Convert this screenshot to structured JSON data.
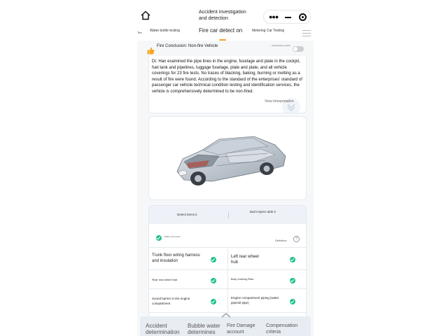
{
  "header": {
    "title_line1": "Accident investigation",
    "title_line2": "and detection",
    "icons": [
      "home-icon",
      "more-icon",
      "minimize-icon",
      "target-icon"
    ]
  },
  "tabs": {
    "side_label": "Tire",
    "items": [
      {
        "label": "Water bottle testing"
      },
      {
        "label": "Fire car detect on"
      },
      {
        "label": "Metering Car Testing"
      }
    ],
    "menu_icon": "menu-icon"
  },
  "conclusion": {
    "text": "Fire Conclusion: Non-fire Vehicle",
    "interp_label": "Interpretation switch"
  },
  "description": {
    "text": "Dr. Han examined the pipe lines in the engine, fuselage and plate in the cockpit, fuel tank and pipelines, luggage fuselage, plate and plate, and all vehicle coverings for 23 fire tests. No traces of blacking, baking, burning or melting as a result of fire were found. According to the standard of the enterprises' standard of passenger car vehicle technical condition testing and identification services, the vehicle is comprehensively determined to be non-fired.",
    "view_link": "View Interpretation"
  },
  "inspection": {
    "header_left": "Detect items it",
    "header_right": "Bad inspect able it",
    "legend_label": "Buffer temp tests",
    "definition_label": "Definition",
    "help_symbol": "?",
    "items": [
      {
        "label": "Trunk floor wiring harness and insulation"
      },
      {
        "label": "Left rear wheel hub"
      },
      {
        "label": "Rear rear wheel hub"
      },
      {
        "label": "Body Covering Parts"
      },
      {
        "label": "Sound barrier in the engine compartment"
      },
      {
        "label": "Engine compartment piping (water pipe/oil pipe)"
      }
    ]
  },
  "bottom_nav": {
    "items": [
      {
        "line1": "Accident",
        "line2": "determination"
      },
      {
        "line1": "Bubble water",
        "line2": "determines"
      },
      {
        "line1": "Fire Damage",
        "line2": "account"
      },
      {
        "line1": "Compensation",
        "line2": "criteria"
      }
    ]
  },
  "colors": {
    "accent": "#f5a623",
    "check": "#1ec08a",
    "header_bg": "#eef2f8",
    "bottom_bg": "#e8ecf3"
  }
}
